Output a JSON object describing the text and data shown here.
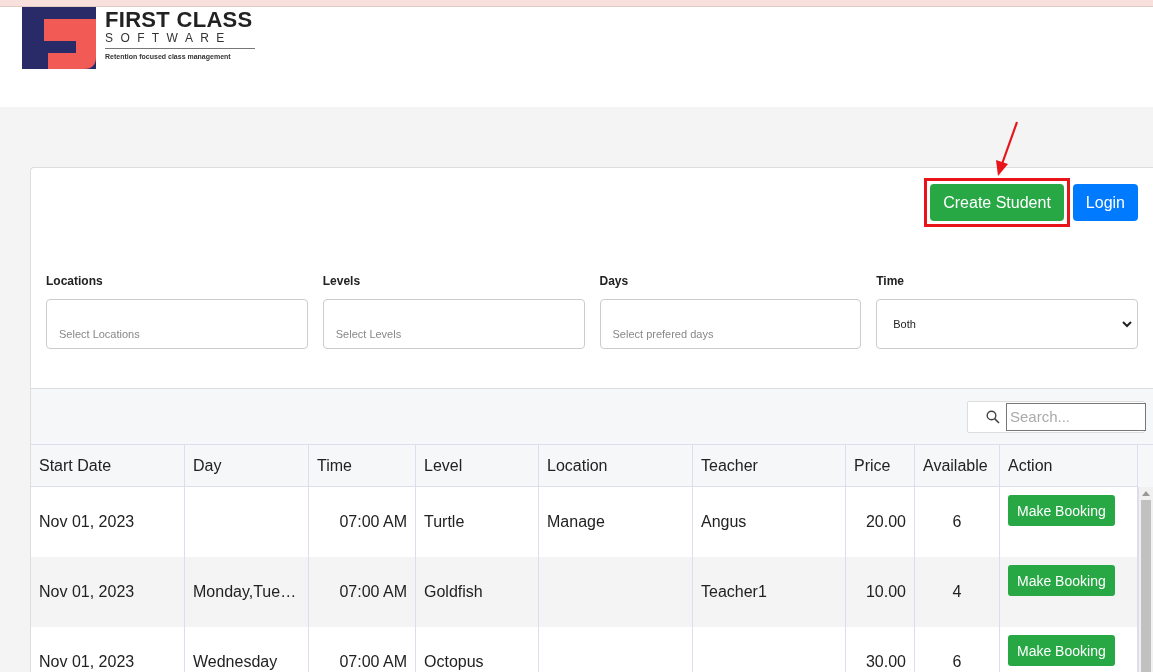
{
  "logo": {
    "title": "FIRST CLASS",
    "subtitle": "SOFTWARE",
    "tagline": "Retention focused class management"
  },
  "actions": [
    {
      "label": "Create Student",
      "kind": "success",
      "highlighted": true
    },
    {
      "label": "Login",
      "kind": "primary",
      "highlighted": false
    }
  ],
  "filters": [
    {
      "label": "Locations",
      "kind": "multiselect",
      "placeholder": "Select Locations"
    },
    {
      "label": "Levels",
      "kind": "multiselect",
      "placeholder": "Select Levels"
    },
    {
      "label": "Days",
      "kind": "multiselect",
      "placeholder": "Select prefered days"
    },
    {
      "label": "Time",
      "kind": "select",
      "value": "Both"
    }
  ],
  "search": {
    "placeholder": "Search..."
  },
  "table": {
    "columns": [
      "Start Date",
      "Day",
      "Time",
      "Level",
      "Location",
      "Teacher",
      "Price",
      "Available",
      "Action"
    ],
    "rows": [
      {
        "start_date": "Nov 01, 2023",
        "day": "",
        "time": "07:00 AM",
        "level": "Turtle",
        "location": "Manage",
        "teacher": "Angus",
        "price": "20.00",
        "available": "6",
        "action": "Make Booking"
      },
      {
        "start_date": "Nov 01, 2023",
        "day": "Monday,Tue…",
        "time": "07:00 AM",
        "level": "Goldfish",
        "location": "",
        "teacher": "Teacher1",
        "price": "10.00",
        "available": "4",
        "action": "Make Booking"
      },
      {
        "start_date": "Nov 01, 2023",
        "day": "Wednesday",
        "time": "07:00 AM",
        "level": "Octopus",
        "location": "",
        "teacher": "",
        "price": "30.00",
        "available": "6",
        "action": "Make Booking"
      }
    ]
  }
}
